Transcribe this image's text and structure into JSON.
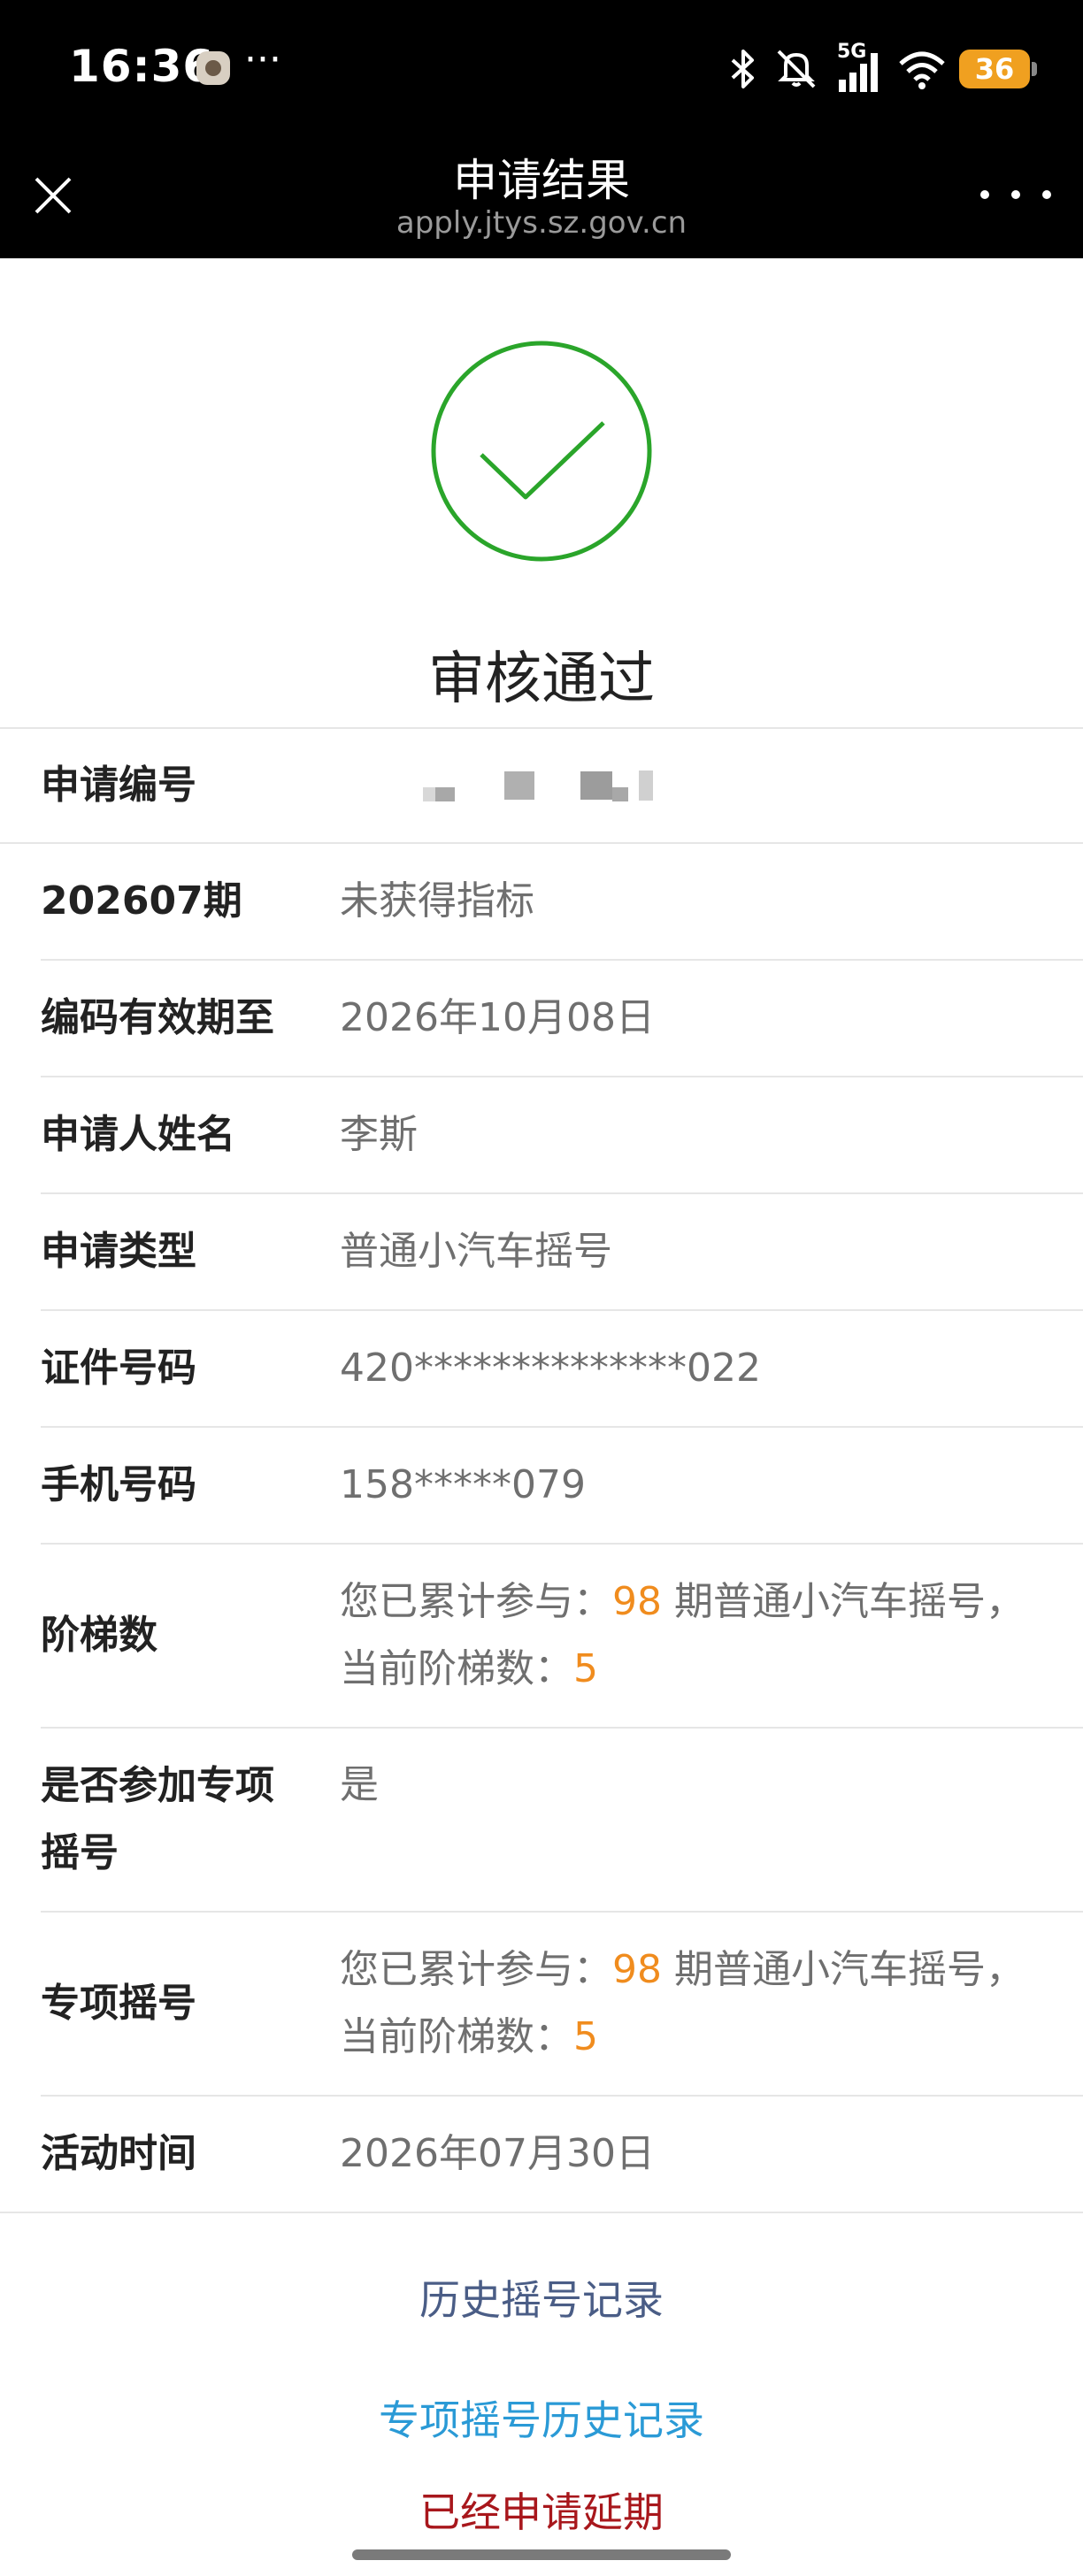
{
  "status_bar": {
    "time": "16:36",
    "more": "···",
    "network": "5G",
    "battery": "36",
    "icons": [
      "app-icon",
      "bluetooth-icon",
      "mute-icon",
      "signal-icon",
      "wifi-icon",
      "battery-icon"
    ]
  },
  "nav": {
    "title": "申请结果",
    "subtitle": "apply.jtys.sz.gov.cn",
    "icons": [
      "close-icon",
      "more-icon"
    ]
  },
  "result": {
    "icon": "check-circle-icon",
    "status": "审核通过",
    "accent_color": "#2aa52a"
  },
  "rows": [
    {
      "label": "申请编号",
      "value": ""
    },
    {
      "label": "202607期",
      "value": "未获得指标"
    },
    {
      "label": "编码有效期至",
      "value": "2026年10月08日"
    },
    {
      "label": "申请人姓名",
      "value": "李斯"
    },
    {
      "label": "申请类型",
      "value": "普通小汽车摇号"
    },
    {
      "label": "证件号码",
      "value": "420**************022"
    },
    {
      "label": "手机号码",
      "value": "158*****079"
    },
    {
      "label": "阶梯数",
      "line1_prefix": "您已累计参与：",
      "count": "98",
      "line1_suffix": "期普通小汽车摇号，",
      "line2_prefix": "当前阶梯数：",
      "level": "5"
    },
    {
      "label_line1": "是否参加专项",
      "label_line2": "摇号",
      "value": "是"
    },
    {
      "label": "专项摇号",
      "line1_prefix": "您已累计参与：",
      "count": "98",
      "line1_suffix": "期普通小汽车摇号，",
      "line2_prefix": "当前阶梯数：",
      "level": "5"
    },
    {
      "label": "活动时间",
      "value": "2026年07月30日"
    }
  ],
  "links": {
    "history": "历史摇号记录",
    "special_history": "专项摇号历史记录",
    "delay": "已经申请延期"
  },
  "colors": {
    "orange": "#f08c1e",
    "link_blue": "#2a9ad6",
    "link_gray_blue": "#4a5d86",
    "dark_red": "#a8171c"
  }
}
